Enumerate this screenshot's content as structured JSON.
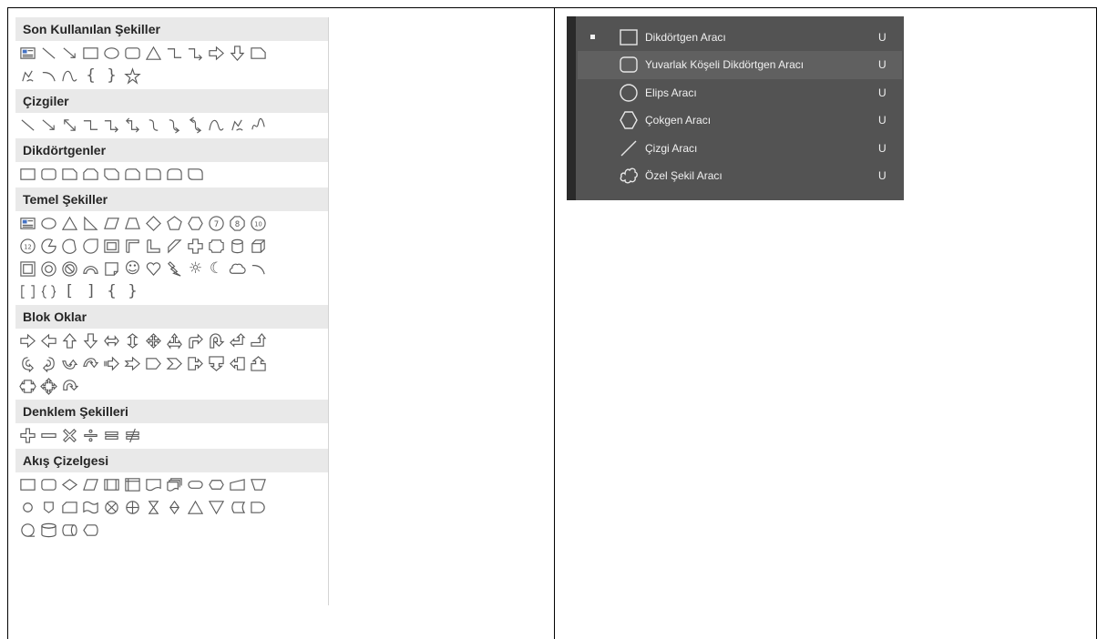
{
  "shapes_gallery": {
    "sections": [
      {
        "title": "Son Kullanılan Şekiller",
        "rows": [
          [
            "text-box-icon",
            "line-icon",
            "arrow-line-icon",
            "rectangle-icon",
            "oval-icon",
            "rounded-rectangle-icon",
            "triangle-icon",
            "elbow-connector-icon",
            "elbow-arrow-connector-icon",
            "right-arrow-icon",
            "down-arrow-icon",
            "snip-corner-icon"
          ],
          [
            "freeform-icon",
            "arc-icon",
            "curve-icon",
            "left-brace-icon",
            "right-brace-icon",
            "star-icon"
          ]
        ]
      },
      {
        "title": "Çizgiler",
        "rows": [
          [
            "line-icon",
            "arrow-line-icon",
            "double-arrow-line-icon",
            "elbow-connector-icon",
            "elbow-arrow-connector-icon",
            "elbow-double-arrow-icon",
            "curved-connector-icon",
            "curved-arrow-connector-icon",
            "curved-double-arrow-icon",
            "curve-icon",
            "freeform-icon",
            "scribble-icon"
          ]
        ]
      },
      {
        "title": "Dikdörtgenler",
        "rows": [
          [
            "rectangle-icon",
            "rounded-rectangle-icon",
            "snip-single-corner-icon",
            "snip-same-side-icon",
            "snip-diagonal-icon",
            "snip-round-icon",
            "round-single-corner-icon",
            "round-same-side-icon",
            "round-diagonal-icon"
          ]
        ]
      },
      {
        "title": "Temel Şekiller",
        "rows": [
          [
            "text-box-icon",
            "oval-icon",
            "triangle-icon",
            "right-triangle-icon",
            "parallelogram-icon",
            "trapezoid-icon",
            "diamond-icon",
            "pentagon-icon",
            "hexagon-icon",
            "heptagon-icon",
            "octagon-icon",
            "decagon-icon"
          ],
          [
            "dodecagon-icon",
            "pie-icon",
            "chord-icon",
            "teardrop-icon",
            "frame-icon",
            "half-frame-icon",
            "l-shape-icon",
            "diagonal-stripe-icon",
            "cross-icon",
            "plaque-icon",
            "can-icon",
            "cube-icon"
          ],
          [
            "bevel-icon",
            "donut-icon",
            "no-symbol-icon",
            "block-arc-icon",
            "folded-corner-icon",
            "smiley-icon",
            "heart-icon",
            "lightning-icon",
            "sun-icon",
            "moon-icon",
            "cloud-icon",
            "arc-icon"
          ],
          [
            "double-bracket-icon",
            "double-brace-icon",
            "left-bracket-icon",
            "right-bracket-icon",
            "left-brace-icon",
            "right-brace-icon"
          ]
        ]
      },
      {
        "title": "Blok Oklar",
        "rows": [
          [
            "right-arrow-icon",
            "left-arrow-icon",
            "up-arrow-icon",
            "down-arrow-icon",
            "left-right-arrow-icon",
            "up-down-arrow-icon",
            "quad-arrow-icon",
            "left-right-up-arrow-icon",
            "bent-arrow-icon",
            "u-turn-arrow-icon",
            "left-up-arrow-icon",
            "bent-up-arrow-icon"
          ],
          [
            "curved-right-arrow-icon",
            "curved-left-arrow-icon",
            "curved-up-arrow-icon",
            "curved-down-arrow-icon",
            "striped-right-arrow-icon",
            "notched-right-arrow-icon",
            "pentagon-arrow-icon",
            "chevron-icon",
            "right-arrow-callout-icon",
            "down-arrow-callout-icon",
            "left-arrow-callout-icon",
            "up-arrow-callout-icon"
          ],
          [
            "left-right-arrow-callout-icon",
            "quad-arrow-callout-icon",
            "circular-arrow-icon"
          ]
        ]
      },
      {
        "title": "Denklem Şekilleri",
        "rows": [
          [
            "plus-icon",
            "minus-icon",
            "multiply-icon",
            "division-icon",
            "equal-icon",
            "not-equal-icon"
          ]
        ]
      },
      {
        "title": "Akış Çizelgesi",
        "rows": [
          [
            "process-icon",
            "alternate-process-icon",
            "decision-icon",
            "data-icon",
            "predefined-process-icon",
            "internal-storage-icon",
            "document-icon",
            "multidocument-icon",
            "terminator-icon",
            "preparation-icon",
            "manual-input-icon",
            "manual-operation-icon"
          ],
          [
            "connector-icon",
            "offpage-connector-icon",
            "card-icon",
            "punched-tape-icon",
            "summing-junction-icon",
            "or-icon",
            "collate-icon",
            "sort-icon",
            "extract-icon",
            "merge-icon",
            "stored-data-icon",
            "delay-icon"
          ],
          [
            "sequential-access-storage-icon",
            "magnetic-disk-icon",
            "direct-access-storage-icon",
            "display-icon"
          ]
        ]
      }
    ]
  },
  "tool_flyout": {
    "items": [
      {
        "label": "Dikdörtgen Aracı",
        "shortcut": "U",
        "icon": "rectangle-tool-icon",
        "active": true,
        "highlighted": false
      },
      {
        "label": "Yuvarlak Köşeli Dikdörtgen Aracı",
        "shortcut": "U",
        "icon": "rounded-rectangle-tool-icon",
        "active": false,
        "highlighted": true
      },
      {
        "label": "Elips Aracı",
        "shortcut": "U",
        "icon": "ellipse-tool-icon",
        "active": false,
        "highlighted": false
      },
      {
        "label": "Çokgen Aracı",
        "shortcut": "U",
        "icon": "polygon-tool-icon",
        "active": false,
        "highlighted": false
      },
      {
        "label": "Çizgi Aracı",
        "shortcut": "U",
        "icon": "line-tool-icon",
        "active": false,
        "highlighted": false
      },
      {
        "label": "Özel Şekil Aracı",
        "shortcut": "U",
        "icon": "custom-shape-tool-icon",
        "active": false,
        "highlighted": false
      }
    ]
  }
}
